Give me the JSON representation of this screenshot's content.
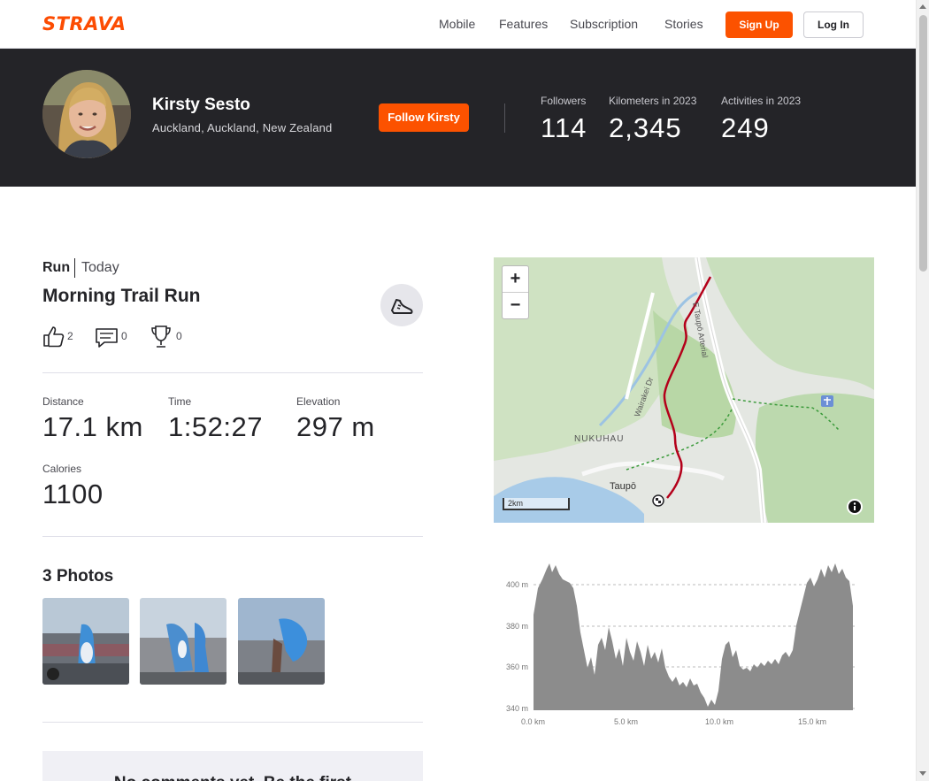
{
  "header": {
    "logo": "STRAVA",
    "nav": [
      "Mobile",
      "Features",
      "Subscription",
      "Stories"
    ],
    "signup_label": "Sign Up",
    "login_label": "Log In"
  },
  "athlete": {
    "name": "Kirsty Sesto",
    "location": "Auckland, Auckland, New Zealand",
    "follow_label": "Follow Kirsty",
    "stats": [
      {
        "label": "Followers",
        "value": "114"
      },
      {
        "label": "Kilometers in 2023",
        "value": "2,345"
      },
      {
        "label": "Activities in 2023",
        "value": "249"
      }
    ]
  },
  "activity": {
    "type": "Run",
    "date": "Today",
    "title": "Morning Trail Run",
    "kudos": "2",
    "comments": "0",
    "achievements": "0",
    "metrics": [
      {
        "label": "Distance",
        "value": "17.1 km"
      },
      {
        "label": "Time",
        "value": "1:52:27"
      },
      {
        "label": "Elevation",
        "value": "297 m"
      },
      {
        "label": "Calories",
        "value": "1100"
      }
    ],
    "photos_title": "3 Photos",
    "no_comments": "No comments yet. Be the first"
  },
  "map": {
    "labels": [
      "E Taupō Arterial",
      "Wairakei Dr",
      "NUKUHAU",
      "Taupō"
    ],
    "scale": "2km",
    "zoom_in": "+",
    "zoom_out": "−"
  },
  "elevation": {
    "y_ticks": [
      "400 m",
      "380 m",
      "360 m",
      "340 m"
    ],
    "x_ticks": [
      "0.0 km",
      "5.0 km",
      "10.0 km",
      "15.0 km"
    ]
  },
  "colors": {
    "brand": "#fc4c02",
    "banner_bg": "#242428",
    "route": "#b4001a"
  }
}
